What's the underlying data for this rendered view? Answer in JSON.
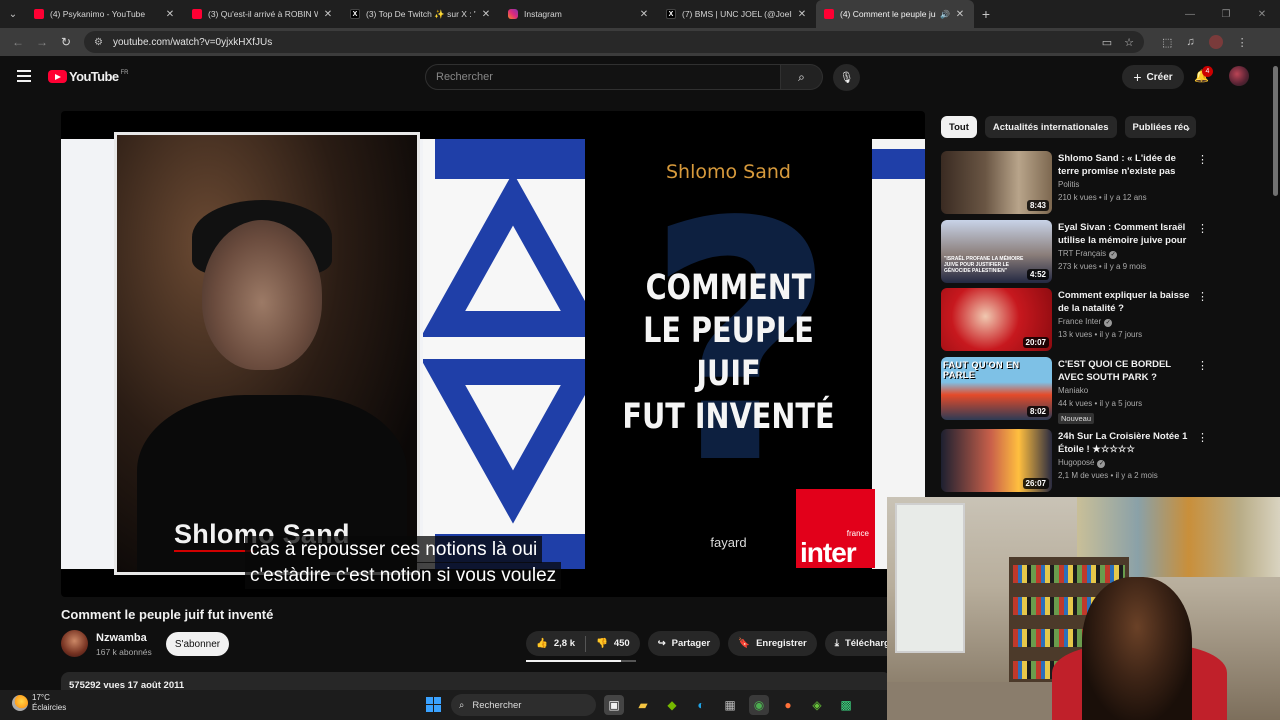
{
  "tabs": [
    {
      "icon": "youtube-icon",
      "title": "(4) Psykanimo - YouTube"
    },
    {
      "icon": "youtube-icon",
      "title": "(3) Qu'est-il arrivé à ROBIN WI…"
    },
    {
      "icon": "x-icon",
      "title": "(3) Top De Twitch ✨ sur X : \"A…"
    },
    {
      "icon": "instagram-icon",
      "title": "Instagram"
    },
    {
      "icon": "x-icon",
      "title": "(7) BMS | UNC JOEL (@JoelPos…"
    },
    {
      "icon": "youtube-icon",
      "title": "(4) Comment le peuple juif…",
      "active": true
    }
  ],
  "url": "youtube.com/watch?v=0yjxkHXfJUs",
  "youtube": {
    "logo_text": "YouTube",
    "country_code": "FR",
    "search_placeholder": "Rechercher",
    "create_label": "Créer",
    "notif_count": "4"
  },
  "player": {
    "lower_third_name": "Shlomo Sand",
    "book_author": "Shlomo Sand",
    "book_title_lines": [
      "COMMENT",
      "LE PEUPLE JUIF",
      "FUT INVENTÉ"
    ],
    "book_publisher": "fayard",
    "logo_small": "france",
    "logo_big": "inter",
    "caption_line1": "cas à repousser ces notions là oui",
    "caption_line2": "c'estàdire c'est notion si vous voulez"
  },
  "video": {
    "title": "Comment le peuple juif fut inventé",
    "channel_name": "Nzwamba",
    "channel_subs": "167 k abonnés",
    "subscribe_label": "S'abonner",
    "likes": "2,8 k",
    "dislikes": "450",
    "share_label": "Partager",
    "save_label": "Enregistrer",
    "download_label": "Télécharger",
    "description_meta": "575292 vues  17 août 2011",
    "like_ratio": 0.86
  },
  "chips": [
    "Tout",
    "Actualités internationales",
    "Publiées réc"
  ],
  "recommendations": [
    {
      "title": "Shlomo Sand : « L'idée de terre promise n'existe pas l'histoire …",
      "channel": "Politis",
      "verified": false,
      "meta": "210 k vues  •  il y a 12 ans",
      "duration": "8:43",
      "badge": ""
    },
    {
      "title": "Eyal Sivan : Comment Israël utilise la mémoire juive pour …",
      "channel": "TRT Français",
      "verified": true,
      "meta": "273 k vues  •  il y a 9 mois",
      "duration": "4:52",
      "badge": "",
      "overlay": "\"ISRAËL PROFANE LA MÉMOIRE JUIVE POUR JUSTIFIER LE GÉNOCIDE PALESTINIEN\""
    },
    {
      "title": "Comment expliquer la baisse de la natalité ?",
      "channel": "France Inter",
      "verified": true,
      "meta": "13 k vues  •  il y a 7 jours",
      "duration": "20:07",
      "badge": ""
    },
    {
      "title": "C'EST QUOI CE BORDEL AVEC SOUTH PARK ?",
      "channel": "Maniako",
      "verified": false,
      "meta": "44 k vues  •  il y a 5 jours",
      "duration": "8:02",
      "badge": "Nouveau",
      "overlay": "FAUT QU'ON EN PARLE"
    },
    {
      "title": "24h Sur La Croisière Notée 1 Étoile ! ★☆☆☆☆",
      "channel": "Hugoposé",
      "verified": true,
      "meta": "2,1 M de vues  •  il y a 2 mois",
      "duration": "26:07",
      "badge": ""
    }
  ],
  "taskbar": {
    "temp": "17°C",
    "weather": "Éclaircies",
    "search_label": "Rechercher"
  }
}
